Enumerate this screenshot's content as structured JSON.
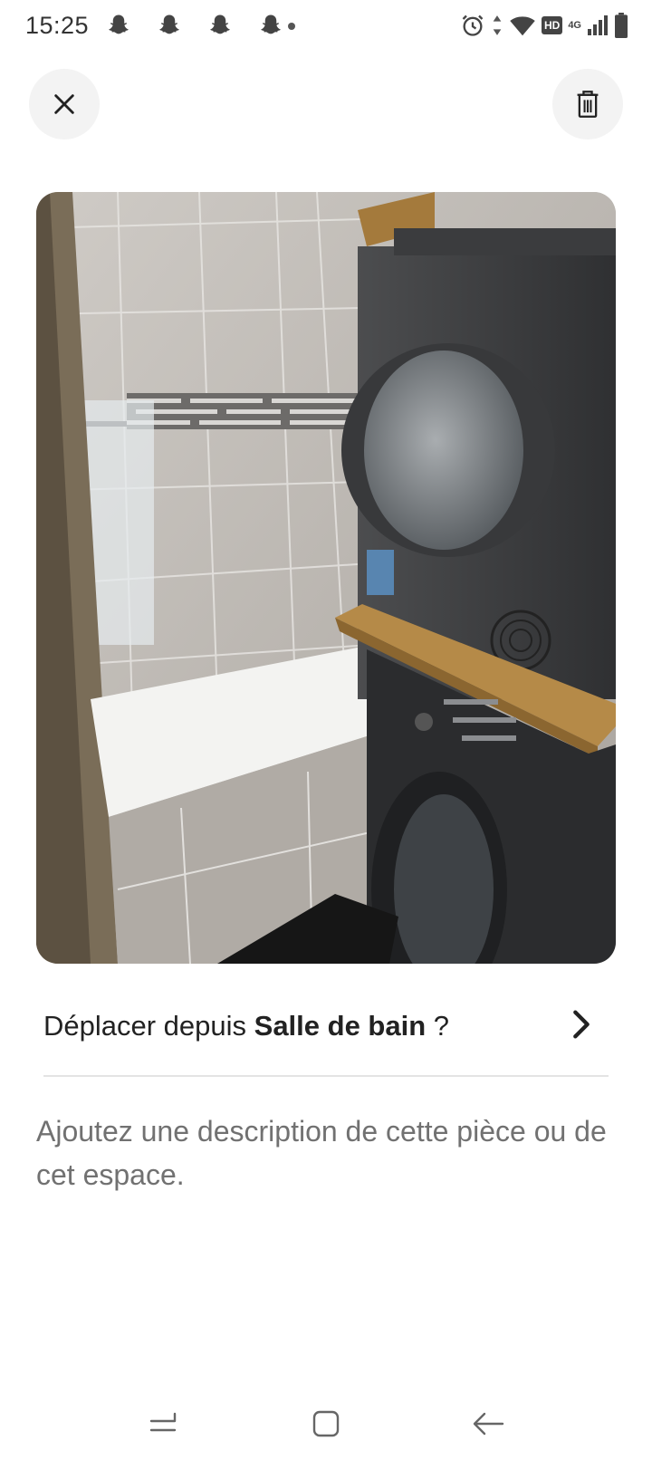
{
  "status_bar": {
    "time": "15:25",
    "left_icons": [
      "snapchat-icon",
      "snapchat-icon",
      "snapchat-icon",
      "snapchat-icon",
      "notification-dot"
    ],
    "right_icons": [
      "alarm-icon",
      "data-arrows-icon",
      "wifi-icon",
      "hd-badge",
      "4g-signal-icon",
      "battery-icon"
    ],
    "hd_label": "HD",
    "network_label": "4G"
  },
  "header": {
    "close_icon": "close-icon",
    "delete_icon": "trash-icon"
  },
  "photo": {
    "subject": "bathroom with bathtub and stacked washer dryer"
  },
  "move": {
    "prefix": "Déplacer depuis ",
    "room": "Salle de bain",
    "suffix": " ?"
  },
  "description": {
    "placeholder": "Ajoutez une description de cette pièce ou de cet espace."
  },
  "nav": {
    "icons": [
      "recent-apps-icon",
      "home-icon",
      "back-icon"
    ]
  },
  "colors": {
    "button_bg": "#f3f3f3",
    "text_primary": "#222222",
    "text_secondary": "#717171",
    "divider": "#e4e4e4"
  }
}
